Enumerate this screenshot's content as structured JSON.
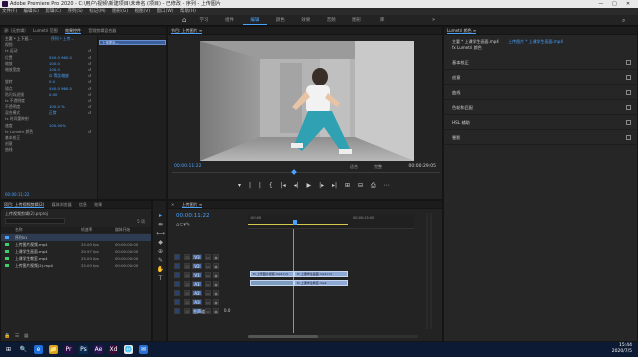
{
  "titlebar": {
    "title": "Adobe Premiere Pro 2020 - C:\\用户\\视频\\新建项目\\未命名 (项目) - 已修改 - 序列 - 上传图片",
    "min": "—",
    "max": "□",
    "close": "✕"
  },
  "menu": [
    "文件(F)",
    "编辑(E)",
    "剪辑(C)",
    "序列(S)",
    "标记(M)",
    "图形(G)",
    "视图(V)",
    "窗口(W)",
    "帮助(H)"
  ],
  "workspaces": {
    "tabs": [
      "学习",
      "组件",
      "编辑",
      "颜色",
      "效果",
      "音频",
      "图形",
      "库"
    ],
    "active_index": 2,
    "more": "»"
  },
  "effect_controls": {
    "tabs": [
      "源: (无剪辑)",
      "Lumetri 范围",
      "效果控件",
      "音频剪辑混合器"
    ],
    "active_index": 2,
    "header": {
      "master": "主要 * 上下班...",
      "seq": "序列 * 上传...",
      "clip_name": "上传图片..."
    },
    "rows": [
      {
        "label": "视频",
        "value": "",
        "key": ""
      },
      {
        "label": "fx 运动",
        "value": "",
        "key": "↺"
      },
      {
        "label": "  位置",
        "value": "540.0  960.0",
        "key": "↺"
      },
      {
        "label": "  缩放",
        "value": "100.0",
        "key": "↺"
      },
      {
        "label": "  缩放宽度",
        "value": "100.0",
        "key": "↺"
      },
      {
        "label": "",
        "value": "☑ 等比缩放",
        "key": "↺"
      },
      {
        "label": "  旋转",
        "value": "0.0",
        "key": "↺"
      },
      {
        "label": "  锚点",
        "value": "540.0  960.0",
        "key": "↺"
      },
      {
        "label": "  防闪烁滤镜",
        "value": "0.00",
        "key": "↺"
      },
      {
        "label": "fx 不透明度",
        "value": "",
        "key": "↺"
      },
      {
        "label": "  不透明度",
        "value": "100.0 %",
        "key": "↺"
      },
      {
        "label": "  混合模式",
        "value": "正常",
        "key": "↺"
      },
      {
        "label": "fx 时间重映射",
        "value": "",
        "key": ""
      },
      {
        "label": "  速度",
        "value": "100.00%",
        "key": ""
      },
      {
        "label": "fx Lumetri 颜色",
        "value": "",
        "key": "↺"
      },
      {
        "label": "  基本校正",
        "value": "",
        "key": ""
      },
      {
        "label": "  创意",
        "value": "",
        "key": ""
      },
      {
        "label": "  曲线",
        "value": "",
        "key": ""
      }
    ],
    "timecode": "00:00:11:22"
  },
  "program_monitor": {
    "title": "节目: 上传图片 ≡",
    "timecode": "00:00:11:22",
    "fit": "适合",
    "quality": "完整",
    "duration": "00:00:29:05",
    "controls": [
      "▾",
      "|",
      "|",
      "{",
      "|◂",
      "◂|",
      "▶",
      "|▸",
      "▸|",
      "⊞",
      "⊟",
      "⎙",
      "⋯"
    ]
  },
  "project": {
    "tabs": [
      "项目: 上传视频剪辑(2)",
      "媒体浏览器",
      "信息",
      "效果"
    ],
    "path": "上传视频剪辑(2).prproj",
    "count": "5 项",
    "columns": [
      "名称",
      "帧速率",
      "媒体开始"
    ],
    "items": [
      {
        "color": "#4aa3ff",
        "name": "序列01",
        "fps": "",
        "start": ""
      },
      {
        "color": "#3ad16d",
        "name": "上传图片视频.mp4",
        "fps": "25.00 fps",
        "start": "00:00:00:00"
      },
      {
        "color": "#3ad16d",
        "name": "上课学生画面.mp4",
        "fps": "29.97 fps",
        "start": "00:00:00:00"
      },
      {
        "color": "#3ad16d",
        "name": "上课学生教室.mp4",
        "fps": "25.00 fps",
        "start": "00:00:00:00"
      },
      {
        "color": "#3ad16d",
        "name": "上传图片视频(2).mp4",
        "fps": "25.00 fps",
        "start": "00:00:00:00"
      }
    ]
  },
  "timeline": {
    "tab": "上传图片 ≡",
    "timecode": "00:00:11:22",
    "ruler": {
      "start": ":00:00",
      "mid": "00:00:15:00",
      "end": "00:00:30:00"
    },
    "tracks": [
      "V3",
      "V2",
      "V1",
      "A1",
      "A2",
      "A3",
      "主声道"
    ],
    "master_value": "0.0",
    "clips": [
      {
        "track": "V1",
        "label": "fx 上传图片视频.mp4 [V]"
      },
      {
        "track": "V1b",
        "label": "fx 上课学生画面.mp4 [V]"
      },
      {
        "track": "A1",
        "label": "fx 上课学生教室.mp4"
      }
    ]
  },
  "lumetri": {
    "title": "Lumetri 颜色 ≡",
    "clip": "主要 * 上课学生画面.mp4",
    "seq": "上传图片 * 上课学生画面.mp4",
    "sections": [
      "基本校正",
      "创意",
      "曲线",
      "色轮和匹配",
      "HSL 辅助",
      "晕影"
    ]
  },
  "tools": [
    "▸",
    "⇹",
    "⟷",
    "◆",
    "⊕",
    "✎",
    "✋",
    "T"
  ],
  "taskbar": {
    "time": "15:44",
    "date": "2020/7/5",
    "icons": [
      "⊞",
      "🔍",
      "e",
      "📁",
      "Pr",
      "Ps",
      "Ae",
      "Xd",
      "🌐",
      "✉"
    ]
  }
}
